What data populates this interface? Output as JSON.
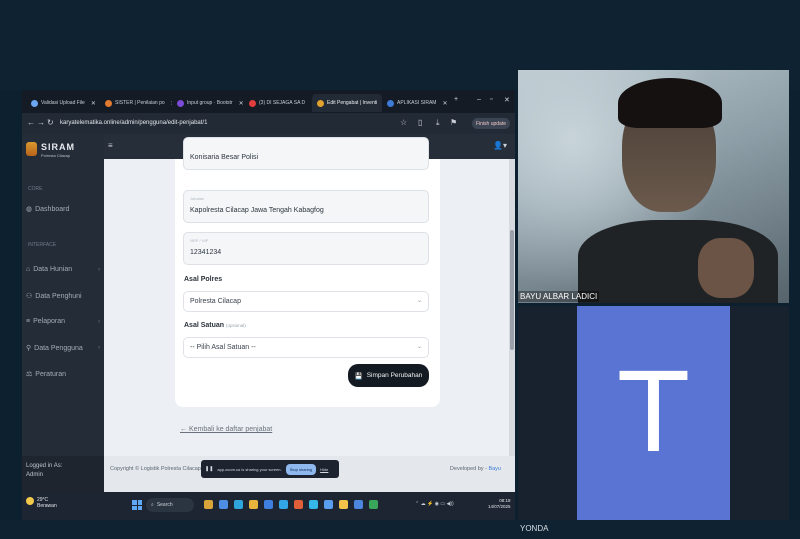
{
  "browser": {
    "tabs": [
      {
        "label": "Validasi Upload File",
        "color": "#6aa7f0"
      },
      {
        "label": "SISTER | Penilaian po",
        "color": "#e27b2f"
      },
      {
        "label": "Input group · Bootstr",
        "color": "#7b4bd6"
      },
      {
        "label": "(3) DI SEJAGA SA D",
        "color": "#e23d3d"
      },
      {
        "label": "Edit Pengabat | Inventi",
        "color": "#e2a02f"
      },
      {
        "label": "APLIKASI SIRAM",
        "color": "#3d7ad6"
      }
    ],
    "url": "karyatelematika.online/admin/pengguna/edit-penjabat/1",
    "update_label": "Finish update"
  },
  "brand": {
    "title": "SIRAM",
    "subtitle": "Polresta Cilacap"
  },
  "sidebar": {
    "sections": [
      "CORE",
      "INTERFACE"
    ],
    "items": [
      {
        "label": "Dashboard",
        "icon": "dashboard-icon",
        "caret": false
      },
      {
        "label": "Data Hunian",
        "icon": "home-icon",
        "caret": true
      },
      {
        "label": "Data Penghuni",
        "icon": "users-icon",
        "caret": false
      },
      {
        "label": "Pelaporan",
        "icon": "report-icon",
        "caret": true
      },
      {
        "label": "Data Pengguna",
        "icon": "user-icon",
        "caret": true
      },
      {
        "label": "Peraturan",
        "icon": "rules-icon",
        "caret": false
      }
    ],
    "footer_label": "Logged in As:",
    "footer_user": "Admin"
  },
  "form": {
    "cut_text": "Konisaria Besar Polisi",
    "jabatan_label": "Jabatan",
    "jabatan_value": "Kapolresta Cilacap Jawa Tengah Kabagfog",
    "nrp_label": "NRP / NIP",
    "nrp_value": "12341234",
    "polres_label": "Asal Polres",
    "polres_value": "Polresta Cilacap",
    "satuan_label": "Asal Satuan",
    "satuan_optional": "(opsional)",
    "satuan_value": "-- Pilih Asal Satuan --",
    "save_label": "Simpan Perubahan",
    "back_label": "Kembali ke daftar penjabat"
  },
  "footer": {
    "copyright": "Copyright © Logistik Polresta Cilacap",
    "devby_prefix": "Developed by",
    "devby_name": "Bayu"
  },
  "share": {
    "text": "app.zoom.us is sharing your screen.",
    "stop_label": "Stop sharing",
    "hide_label": "Hide"
  },
  "taskbar": {
    "temp": "29°C",
    "weather": "Berawan",
    "search": "Search",
    "time": "08:18",
    "date": "14/07/2025"
  },
  "meeting": {
    "participant1": "BAYU ALBAR LADICI",
    "avatar_letter": "T",
    "participant2": "YONDA"
  }
}
